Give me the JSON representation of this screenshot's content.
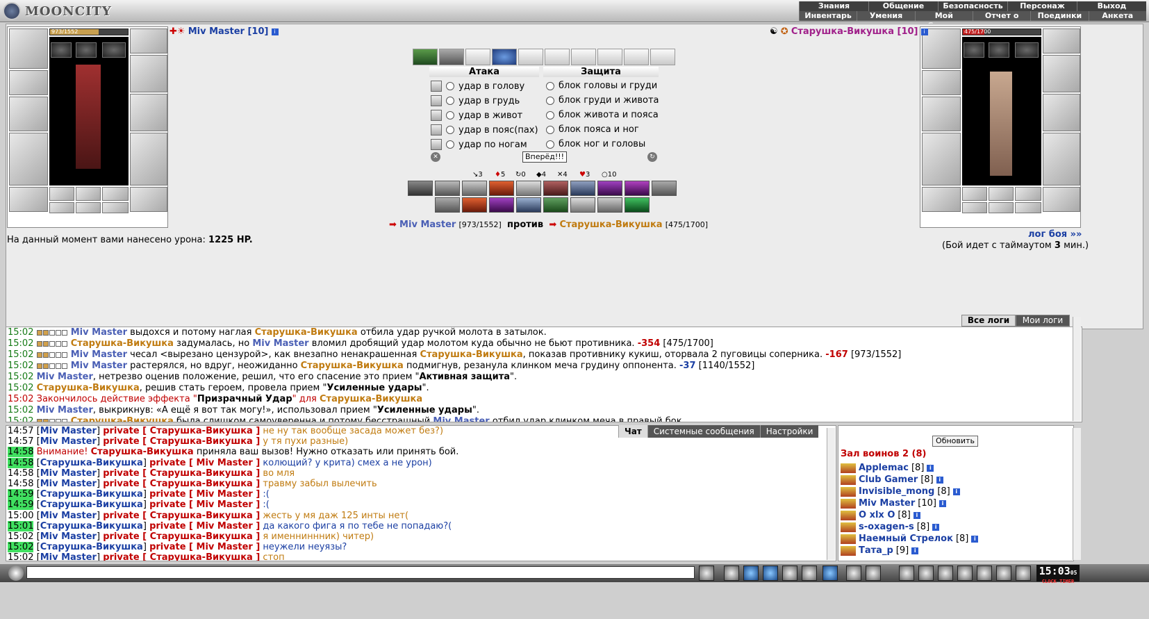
{
  "app": {
    "logo_text": "MOONCITY"
  },
  "menu": {
    "main": [
      "Знания",
      "Общение",
      "Безопасность",
      "Персонаж",
      "Выход"
    ],
    "sub": [
      "Инвентарь",
      "Умения",
      "Мой Скролл",
      "Отчет о переводах",
      "Поединки",
      "Анкета"
    ]
  },
  "player": {
    "name": "Miv Master [10]",
    "hp": "973/1552",
    "hp_value": 973,
    "hp_max": 1552
  },
  "enemy": {
    "name": "Старушка-Викушка [10]",
    "hp": "475/1700",
    "hp_value": 475,
    "hp_max": 1700
  },
  "combat": {
    "attack_header": "Атака",
    "defense_header": "Защита",
    "attacks": [
      "удар в голову",
      "удар в грудь",
      "удар в живот",
      "удар в пояс(пах)",
      "удар по ногам"
    ],
    "defenses": [
      "блок головы и груди",
      "блок груди и живота",
      "блок живота и пояса",
      "блок пояса и ног",
      "блок ног и головы"
    ],
    "go_button": "Вперёд!!!",
    "stats": [
      "3",
      "5",
      "0",
      "4",
      "4",
      "3",
      "10"
    ]
  },
  "duel": {
    "p1_name": "Miv Master",
    "p1_hp": "[973/1552]",
    "vs": "против",
    "p2_name": "Старушка-Викушка",
    "p2_hp": "[475/1700]"
  },
  "damage": {
    "prefix": "На данный момент вами нанесено урона:",
    "value": "1225 HP."
  },
  "battle_log_link": "лог боя »»",
  "timeout": {
    "prefix": "(Бой идет с таймаутом",
    "value": "3",
    "suffix": "мин.)"
  },
  "log_tabs": [
    "Все логи",
    "Мои логи"
  ],
  "battle_log": [
    {
      "time": "15:02",
      "parts": [
        [
          "mm",
          "Miv Master"
        ],
        [
          "",
          " выдохся и потому наглая "
        ],
        [
          "sv",
          "Старушка-Викушка"
        ],
        [
          "",
          " отбила удар ручкой молота в затылок."
        ]
      ]
    },
    {
      "time": "15:02",
      "parts": [
        [
          "sv",
          "Старушка-Викушка"
        ],
        [
          "",
          " задумалась, но "
        ],
        [
          "mm",
          "Miv Master"
        ],
        [
          "",
          " вломил дробящий удар молотом куда обычно не бьют противника. "
        ],
        [
          "dmg",
          "-354"
        ],
        [
          "",
          " [475/1700]"
        ]
      ]
    },
    {
      "time": "15:02",
      "parts": [
        [
          "mm",
          "Miv Master"
        ],
        [
          "",
          " чесал <вырезано цензурой>, как внезапно ненакрашенная "
        ],
        [
          "sv",
          "Старушка-Викушка"
        ],
        [
          "",
          ", показав противнику кукиш, оторвала 2 пуговицы соперника. "
        ],
        [
          "dmg",
          "-167"
        ],
        [
          "",
          " [973/1552]"
        ]
      ]
    },
    {
      "time": "15:02",
      "parts": [
        [
          "mm",
          "Miv Master"
        ],
        [
          "",
          " растерялся, но вдруг, неожиданно "
        ],
        [
          "sv",
          "Старушка-Викушка"
        ],
        [
          "",
          " подмигнув, резанула клинком меча грудину оппонента. "
        ],
        [
          "dmgb",
          "-37"
        ],
        [
          "",
          " [1140/1552]"
        ]
      ]
    },
    {
      "time": "15:02",
      "parts": [
        [
          "mm",
          "Miv Master"
        ],
        [
          "",
          ", нетрезво оценив положение, решил, что его спасение это прием \""
        ],
        [
          "b",
          "Активная защита"
        ],
        [
          "",
          "\"."
        ]
      ]
    },
    {
      "time": "15:02",
      "parts": [
        [
          "sv",
          "Старушка-Викушка"
        ],
        [
          "",
          ", решив стать героем, провела прием \""
        ],
        [
          "b",
          "Усиленные удары"
        ],
        [
          "",
          "\"."
        ]
      ]
    },
    {
      "time": "15:02",
      "red": true,
      "parts": [
        [
          "",
          "Закончилось действие эффекта \""
        ],
        [
          "b",
          "Призрачный Удар"
        ],
        [
          "",
          "\" для "
        ],
        [
          "sv",
          "Старушка-Викушка"
        ]
      ]
    },
    {
      "time": "15:02",
      "parts": [
        [
          "mm",
          "Miv Master"
        ],
        [
          "",
          ", выкрикнув: «А ещё я вот так могу!», использовал прием \""
        ],
        [
          "b",
          "Усиленные удары"
        ],
        [
          "",
          "\"."
        ]
      ]
    },
    {
      "time": "15:02",
      "parts": [
        [
          "sv",
          "Старушка-Викушка"
        ],
        [
          "",
          " была слишком самоуверенна и потому бесстрашный "
        ],
        [
          "mm",
          "Miv Master"
        ],
        [
          "",
          " отбил удар клинком меча в правый бок."
        ]
      ]
    }
  ],
  "chat_tabs": [
    "Чат",
    "Системные сообщения",
    "Настройки"
  ],
  "chat": [
    {
      "time": "14:57",
      "hl": false,
      "from": "Miv Master",
      "to": "Старушка-Викушка",
      "msg": "не ну так вообще засада может без?)",
      "o": true
    },
    {
      "time": "14:57",
      "hl": false,
      "from": "Miv Master",
      "to": "Старушка-Викушка",
      "msg": "у тя пухи разные)",
      "o": true
    },
    {
      "time": "14:58",
      "hl": true,
      "system": "Внимание!",
      "from": "Старушка-Викушка",
      "msg": "приняла ваш вызов! Нужно отказать или принять бой."
    },
    {
      "time": "14:58",
      "hl": true,
      "from": "Старушка-Викушка",
      "to": "Miv Master",
      "msg": "колющий? у крита) смех а не урон)",
      "o": false
    },
    {
      "time": "14:58",
      "hl": false,
      "from": "Miv Master",
      "to": "Старушка-Викушка",
      "msg": "во мля",
      "o": true
    },
    {
      "time": "14:58",
      "hl": false,
      "from": "Miv Master",
      "to": "Старушка-Викушка",
      "msg": "травму забыл вылечить",
      "o": true
    },
    {
      "time": "14:59",
      "hl": true,
      "from": "Старушка-Викушка",
      "to": "Miv Master",
      "msg": ":(",
      "o": false
    },
    {
      "time": "14:59",
      "hl": true,
      "from": "Старушка-Викушка",
      "to": "Miv Master",
      "msg": ":(",
      "o": false
    },
    {
      "time": "15:00",
      "hl": false,
      "from": "Miv Master",
      "to": "Старушка-Викушка",
      "msg": "жесть у мя даж 125 инты нет(",
      "o": true
    },
    {
      "time": "15:01",
      "hl": true,
      "from": "Старушка-Викушка",
      "to": "Miv Master",
      "msg": "да какого фига я по тебе не попадаю?(",
      "o": false
    },
    {
      "time": "15:02",
      "hl": false,
      "from": "Miv Master",
      "to": "Старушка-Викушка",
      "msg": "я именниннник) читер)",
      "o": true
    },
    {
      "time": "15:02",
      "hl": true,
      "from": "Старушка-Викушка",
      "to": "Miv Master",
      "msg": "неужели неуязы?",
      "o": false
    },
    {
      "time": "15:02",
      "hl": false,
      "from": "Miv Master",
      "to": "Старушка-Викушка",
      "msg": "стоп",
      "o": true
    }
  ],
  "chat_private": "private",
  "userlist": {
    "refresh": "Обновить",
    "room": "Зал воинов 2 (8)",
    "users": [
      {
        "name": "Applemac",
        "level": "[8]"
      },
      {
        "name": "Club Gamer",
        "level": "[8]"
      },
      {
        "name": "Invisible_mong",
        "level": "[8]"
      },
      {
        "name": "Miv Master",
        "level": "[10]"
      },
      {
        "name": "O xlx O",
        "level": "[8]"
      },
      {
        "name": "s-oxagen-s",
        "level": "[8]"
      },
      {
        "name": "Наемный Стрелок",
        "level": "[8]"
      },
      {
        "name": "Тата_p",
        "level": "[9]"
      }
    ]
  },
  "clock": {
    "time": "15:03",
    "sec": "05",
    "label": "CLOCK TIMER"
  },
  "colors": {
    "player": "#4a5fb5",
    "enemy": "#c07b10",
    "damage": "#c00000",
    "highlight": "#40e060"
  }
}
